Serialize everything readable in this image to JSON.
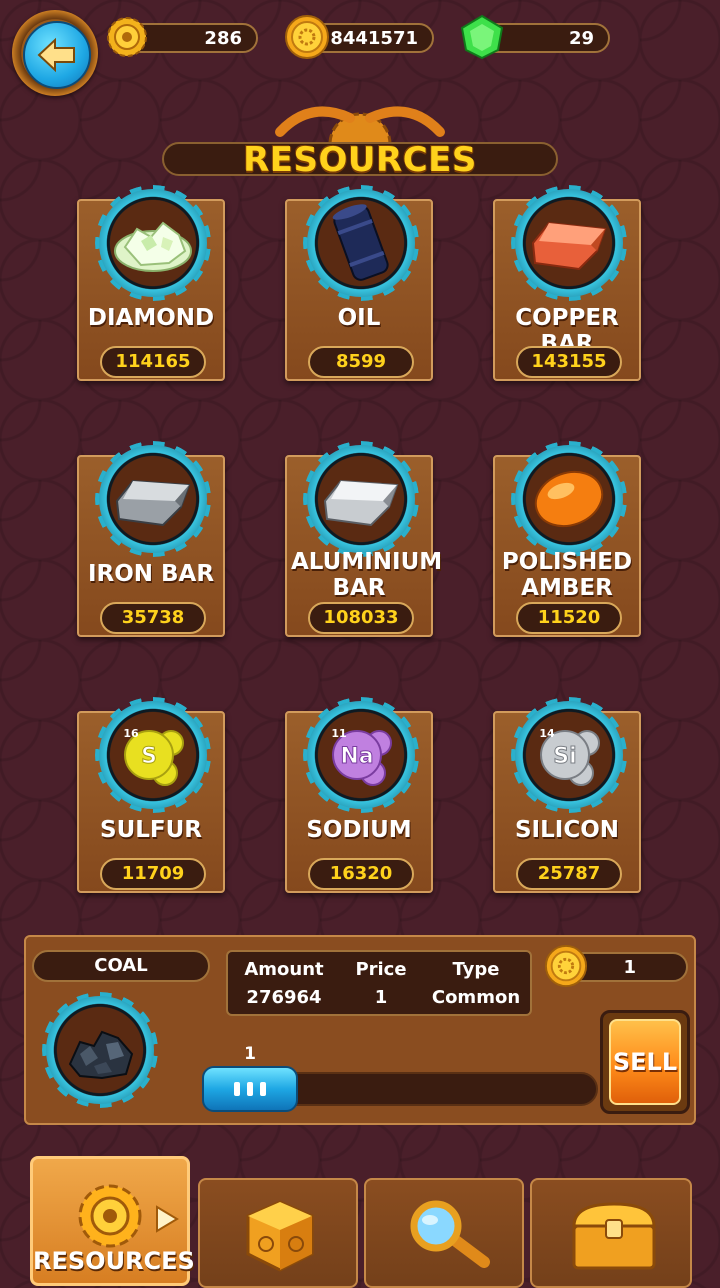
{
  "header": {
    "gears": "286",
    "coins": "8441571",
    "gems": "29"
  },
  "title": "RESOURCES",
  "resources": [
    {
      "name": "DIAMOND",
      "value": "114165",
      "icon": "diamond-icon"
    },
    {
      "name": "OIL",
      "value": "8599",
      "icon": "oil-barrel-icon"
    },
    {
      "name": "COPPER BAR",
      "value": "143155",
      "icon": "copper-bar-icon"
    },
    {
      "name": "IRON BAR",
      "value": "35738",
      "icon": "iron-bar-icon"
    },
    {
      "name": "ALUMINIUM BAR",
      "value": "108033",
      "icon": "aluminium-bar-icon"
    },
    {
      "name": "POLISHED AMBER",
      "value": "11520",
      "icon": "amber-icon"
    },
    {
      "name": "SULFUR",
      "value": "11709",
      "icon": "sulfur-icon",
      "symbol": "S",
      "number": "16"
    },
    {
      "name": "SODIUM",
      "value": "16320",
      "icon": "sodium-icon",
      "symbol": "Na",
      "number": "11"
    },
    {
      "name": "SILICON",
      "value": "25787",
      "icon": "silicon-icon",
      "symbol": "Si",
      "number": "14"
    }
  ],
  "sell_panel": {
    "item_name": "COAL",
    "amount_label": "Amount",
    "amount": "276964",
    "price_label": "Price",
    "price": "1",
    "type_label": "Type",
    "type": "Common",
    "total": "1",
    "slider_value": "1",
    "sell_label": "SELL"
  },
  "tabs": {
    "active_label": "RESOURCES"
  },
  "colors": {
    "background": "#4a1f2a",
    "accent_gold": "#ffd21c",
    "sell_orange": "#ff8c1a",
    "gear_teal": "#2ab0cc"
  }
}
